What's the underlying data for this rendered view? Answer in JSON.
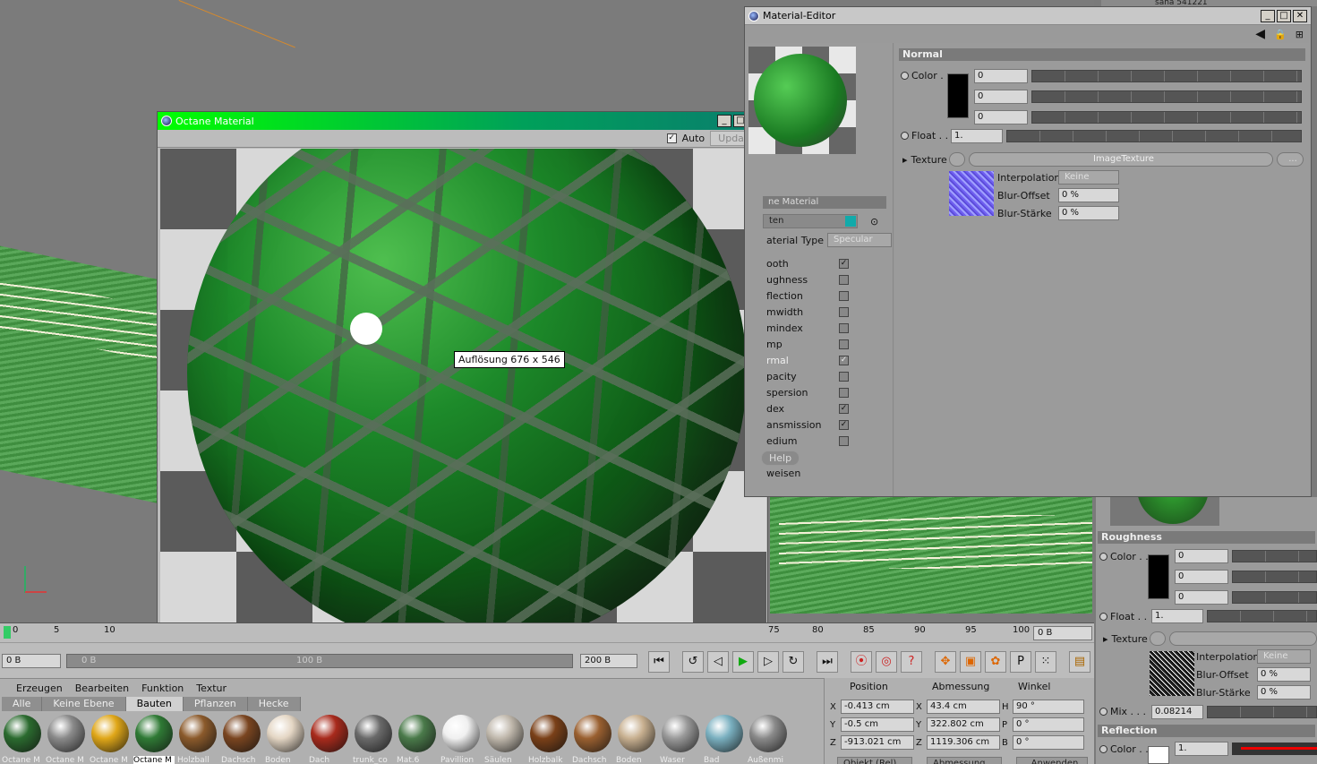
{
  "octane_window": {
    "title": "Octane Material",
    "auto_label": "Auto",
    "update_label": "Update",
    "tooltip": "Auflösung 676 x 546"
  },
  "material_editor": {
    "title": "Material-Editor",
    "material_name": "ne Material",
    "name_field": "ten",
    "material_type_label": "aterial Type",
    "material_type_value": "Specular",
    "channels": [
      {
        "label": "ooth",
        "checked": true
      },
      {
        "label": "ughness",
        "checked": false
      },
      {
        "label": "flection",
        "checked": false
      },
      {
        "label": "mwidth",
        "checked": false
      },
      {
        "label": "mindex",
        "checked": false
      },
      {
        "label": "mp",
        "checked": false
      },
      {
        "label": "rmal",
        "checked": true
      },
      {
        "label": "pacity",
        "checked": false
      },
      {
        "label": "spersion",
        "checked": false
      },
      {
        "label": "dex",
        "checked": true
      },
      {
        "label": "ansmission",
        "checked": true
      },
      {
        "label": "edium",
        "checked": false
      }
    ],
    "help_label": "Help",
    "assign_label": "weisen",
    "section": "Normal",
    "color_label": "Color . .",
    "color_values": [
      "0",
      "0",
      "0"
    ],
    "float_label": "Float . .",
    "float_value": "1.",
    "texture_label": "Texture",
    "texture_name": "ImageTexture",
    "texture_more": "...",
    "interpolation_label": "Interpolation",
    "interpolation_value": "Keine",
    "blur_offset_label": "Blur-Offset",
    "blur_offset_value": "0 %",
    "blur_strength_label": "Blur-Stärke",
    "blur_strength_value": "0 %"
  },
  "attributes": {
    "top_label": "saha 541221",
    "roughness_section": "Roughness",
    "color_label": "Color . .",
    "color_values": [
      "0",
      "0",
      "0"
    ],
    "float_label": "Float . .",
    "float_value": "1.",
    "texture_label": "Texture",
    "interpolation_label": "Interpolation",
    "interpolation_value": "Keine",
    "blur_offset_label": "Blur-Offset",
    "blur_offset_value": "0 %",
    "blur_strength_label": "Blur-Stärke",
    "blur_strength_value": "0 %",
    "mix_label": "Mix . . .",
    "mix_value": "0.08214",
    "reflection_section": "Reflection",
    "refl_color_label": "Color . .",
    "refl_color_value": "1."
  },
  "timeline": {
    "ticks_left": [
      "0",
      "5",
      "10"
    ],
    "ticks_right": [
      "75",
      "80",
      "85",
      "90",
      "95",
      "100"
    ],
    "current_frame": "0 B"
  },
  "transport": {
    "start_field": "0 B",
    "range_start": "0 B",
    "range_end": "100 B",
    "end_field": "200 B"
  },
  "material_manager": {
    "menu": [
      "Erzeugen",
      "Bearbeiten",
      "Funktion",
      "Textur"
    ],
    "tabs": [
      "Alle",
      "Keine Ebene",
      "Bauten",
      "Pflanzen",
      "Hecke"
    ],
    "active_tab": "Bauten",
    "materials": [
      {
        "label": "Octane M",
        "color": "#2b6b2f"
      },
      {
        "label": "Octane M",
        "color": "#8a8a8a"
      },
      {
        "label": "Octane M",
        "color": "#e0a718"
      },
      {
        "label": "Octane M",
        "color": "#2f7a35"
      },
      {
        "label": "Holzball",
        "color": "#8b5a2b"
      },
      {
        "label": "Dachsch",
        "color": "#7a4520"
      },
      {
        "label": "Boden",
        "color": "#e4d6c4"
      },
      {
        "label": "Dach",
        "color": "#a82a1c"
      },
      {
        "label": "trunk_co",
        "color": "#6a6a6a"
      },
      {
        "label": "Mat.6",
        "color": "#4a7a4a"
      },
      {
        "label": "Pavillion",
        "color": "#f0f0f0"
      },
      {
        "label": "Säulen",
        "color": "#c0b8ac"
      },
      {
        "label": "Holzbalk",
        "color": "#7a4018"
      },
      {
        "label": "Dachsch",
        "color": "#9a6030"
      },
      {
        "label": "Boden",
        "color": "#c8b090"
      },
      {
        "label": "Waser",
        "color": "#9a9a9a"
      },
      {
        "label": "Bad",
        "color": "#7ab0c0"
      },
      {
        "label": "Außenmi",
        "color": "#8a8a8a"
      }
    ]
  },
  "coordinates": {
    "headers": [
      "Position",
      "Abmessung",
      "Winkel"
    ],
    "rows": [
      {
        "axis": "X",
        "pos": "-0.413 cm",
        "dim_axis": "X",
        "dim": "43.4 cm",
        "ang_axis": "H",
        "ang": "90 °"
      },
      {
        "axis": "Y",
        "pos": "-0.5 cm",
        "dim_axis": "Y",
        "dim": "322.802 cm",
        "ang_axis": "P",
        "ang": "0 °"
      },
      {
        "axis": "Z",
        "pos": "-913.021 cm",
        "dim_axis": "Z",
        "dim": "1119.306 cm",
        "ang_axis": "B",
        "ang": "0 °"
      }
    ],
    "mode_a": "Objekt (Rel)",
    "mode_b": "Abmessung",
    "apply": "Anwenden"
  }
}
